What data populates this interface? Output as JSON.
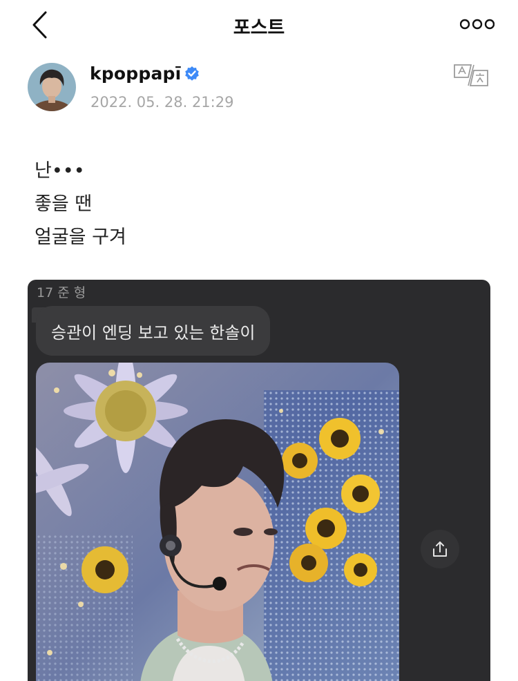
{
  "header": {
    "title": "포스트",
    "back_icon": "chevron-left-icon",
    "more_icon": "more-dots-icon"
  },
  "post": {
    "username": "kpoppapī",
    "verified": true,
    "timestamp": "2022. 05. 28. 21:29",
    "text_lines": [
      "난•••",
      "좋을 땐",
      "얼굴을 구겨"
    ],
    "translate_icon": "translate-icon"
  },
  "embed": {
    "sender": "17 준 형",
    "message": "승관이 엔딩 보고 있는 한솔이",
    "share_icon": "share-icon"
  },
  "colors": {
    "verified_blue": "#3d8af7",
    "embed_background": "#2b2b2d",
    "bubble_background": "#3b3b3d",
    "timestamp_gray": "#a6a6a6"
  }
}
